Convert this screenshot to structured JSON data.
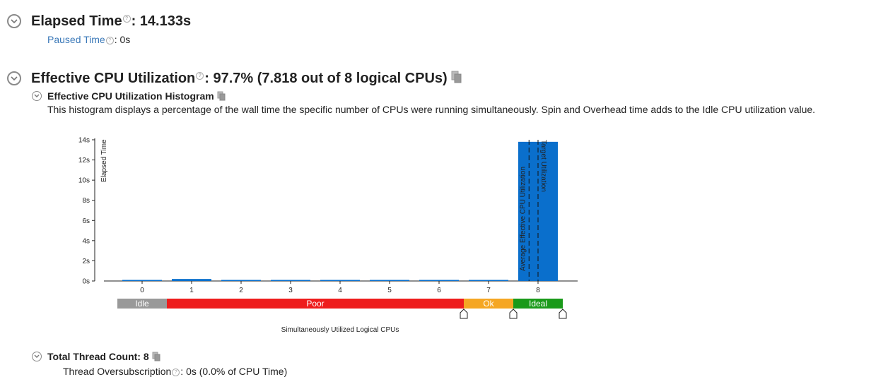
{
  "elapsed": {
    "label": "Elapsed Time",
    "value": ": 14.133s",
    "paused_label": "Paused Time",
    "paused_value": ":  0s"
  },
  "cpu": {
    "label": "Effective CPU Utilization",
    "value": ": 97.7% (7.818 out of 8 logical CPUs)",
    "histogram_title": "Effective CPU Utilization Histogram",
    "histogram_desc": "This histogram displays a percentage of the wall time the specific number of CPUs were running simultaneously. Spin and Overhead time adds to the Idle CPU utilization value."
  },
  "threads": {
    "label": "Total Thread Count: 8",
    "oversub_label": "Thread Oversubscription",
    "oversub_value": ":  0s (0.0% of CPU Time)"
  },
  "colors": {
    "bar": "#0a6fcc",
    "idle": "#999999",
    "poor": "#ee1c1c",
    "ok": "#f5a623",
    "ideal": "#1a9a1a"
  },
  "chart_data": {
    "type": "bar",
    "categories": [
      "0",
      "1",
      "2",
      "3",
      "4",
      "5",
      "6",
      "7",
      "8"
    ],
    "values": [
      0.05,
      0.2,
      0.05,
      0.05,
      0.05,
      0.05,
      0.05,
      0.05,
      13.8
    ],
    "ylabel": "Elapsed Time",
    "xlabel": "Simultaneously Utilized Logical CPUs",
    "ylim": [
      0,
      14
    ],
    "yticks": [
      "0s",
      "2s",
      "4s",
      "6s",
      "8s",
      "10s",
      "12s",
      "14s"
    ],
    "yvalues": [
      0,
      2,
      4,
      6,
      8,
      10,
      12,
      14
    ],
    "markers": [
      {
        "label": "Average Effective CPU Utilization",
        "x": 7.818
      },
      {
        "label": "Target Utilization",
        "x": 8
      }
    ],
    "zones": [
      {
        "label": "Idle",
        "from": -0.5,
        "to": 0.5,
        "color": "#999999"
      },
      {
        "label": "Poor",
        "from": 0.5,
        "to": 6.5,
        "color": "#ee1c1c"
      },
      {
        "label": "Ok",
        "from": 6.5,
        "to": 7.5,
        "color": "#f5a623"
      },
      {
        "label": "Ideal",
        "from": 7.5,
        "to": 8.5,
        "color": "#1a9a1a"
      }
    ],
    "handles": [
      6.5,
      7.5,
      8.5
    ]
  }
}
